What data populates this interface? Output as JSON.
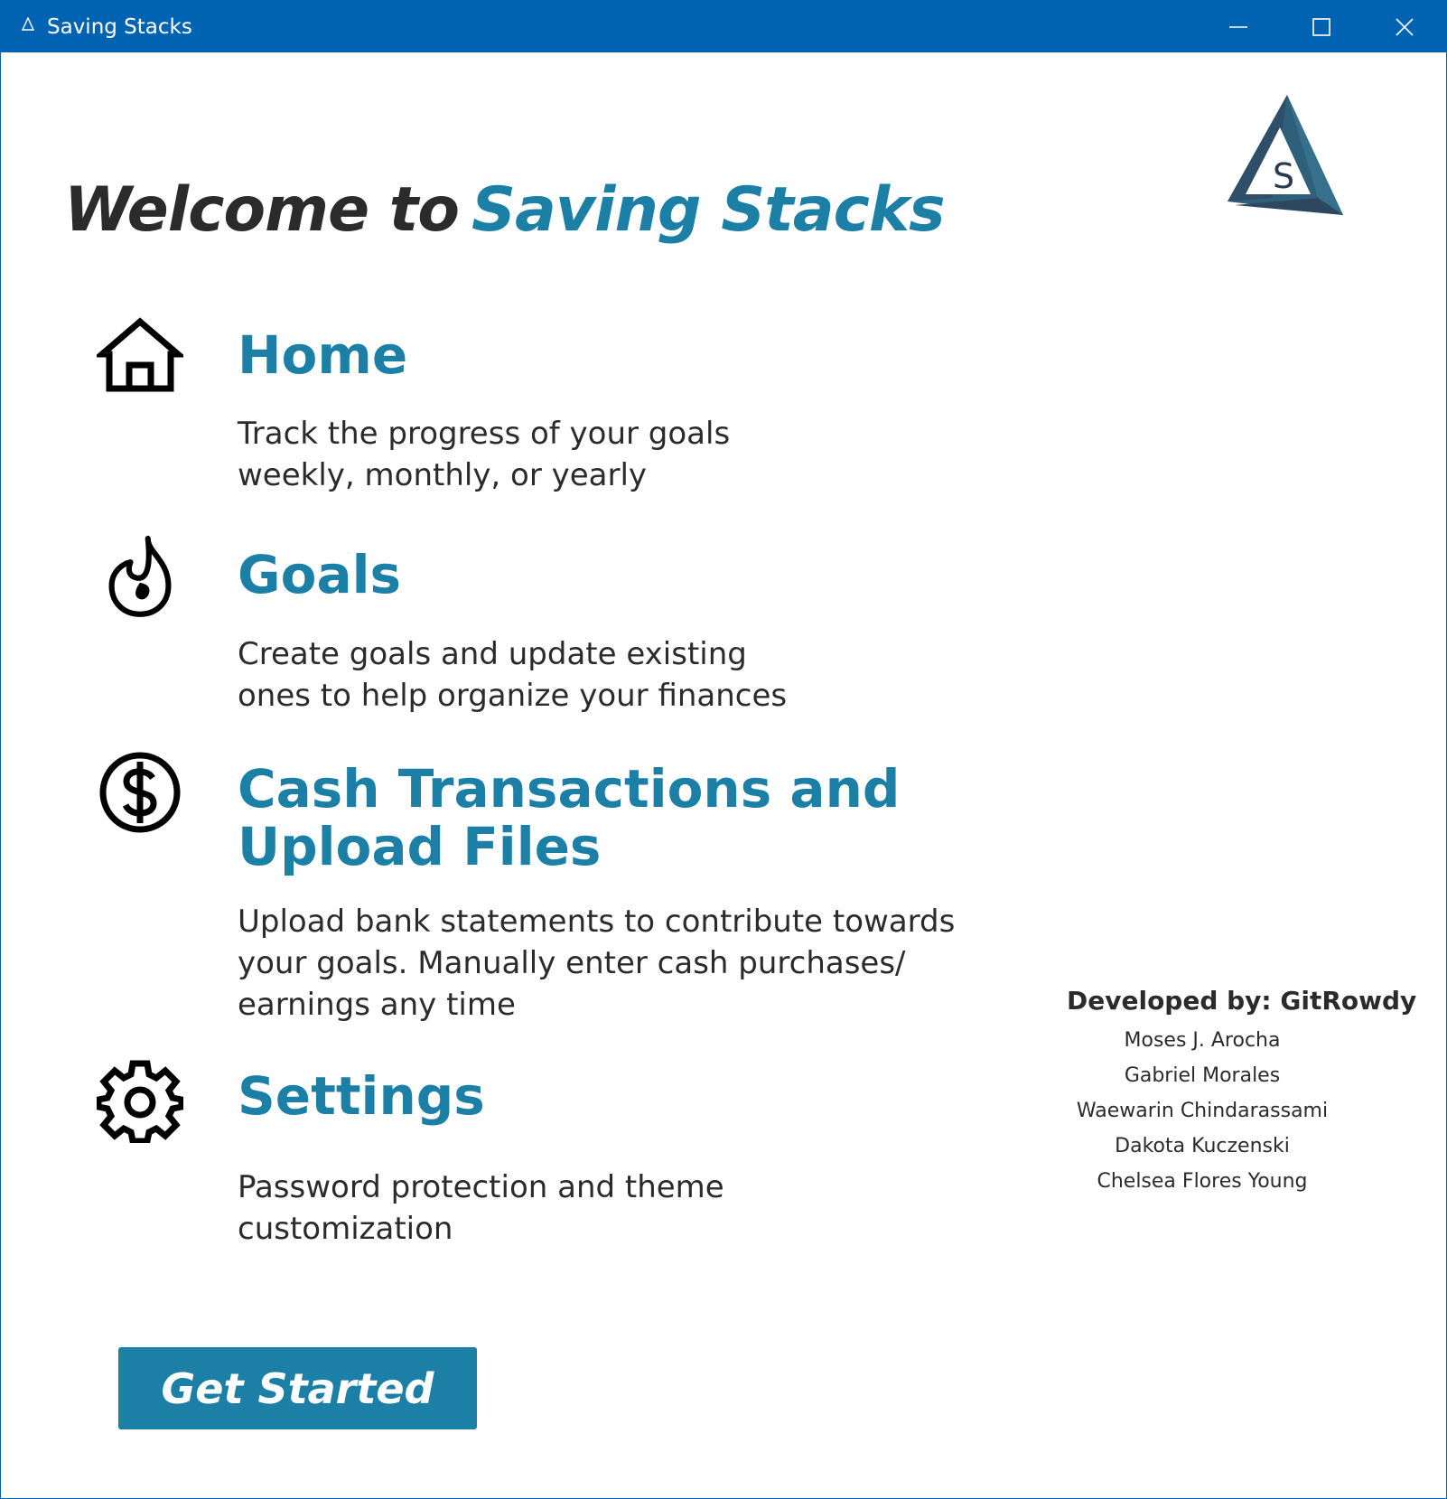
{
  "window": {
    "title": "Saving Stacks",
    "controls": {
      "minimize": "minimize-icon",
      "maximize": "maximize-icon",
      "close": "close-icon"
    },
    "titlebar_color": "#0063b1"
  },
  "header": {
    "welcome_prefix": "Welcome to",
    "app_name": "Saving Stacks"
  },
  "logo": {
    "letter": "S"
  },
  "features": [
    {
      "icon": "home-icon",
      "title": "Home",
      "description": [
        "Track the progress of your goals",
        "weekly, monthly, or yearly"
      ]
    },
    {
      "icon": "flame-icon",
      "title": "Goals",
      "description": [
        "Create goals and update existing",
        "ones to help organize your finances"
      ]
    },
    {
      "icon": "dollar-icon",
      "title": [
        "Cash Transactions and",
        "Upload Files"
      ],
      "description": [
        "Upload bank statements to contribute towards",
        "your goals. Manually enter cash purchases/",
        "earnings any time"
      ]
    },
    {
      "icon": "gear-icon",
      "title": "Settings",
      "description": [
        "Password protection and theme",
        "customization"
      ]
    }
  ],
  "developers": {
    "heading": "Developed by: GitRowdy",
    "names": [
      "Moses J. Arocha",
      "Gabriel Morales",
      "Waewarin Chindarassami",
      "Dakota Kuczenski",
      "Chelsea Flores Young"
    ]
  },
  "actions": {
    "get_started": "Get Started"
  },
  "colors": {
    "accent": "#1b7fa6",
    "text": "#2b2b2b"
  }
}
